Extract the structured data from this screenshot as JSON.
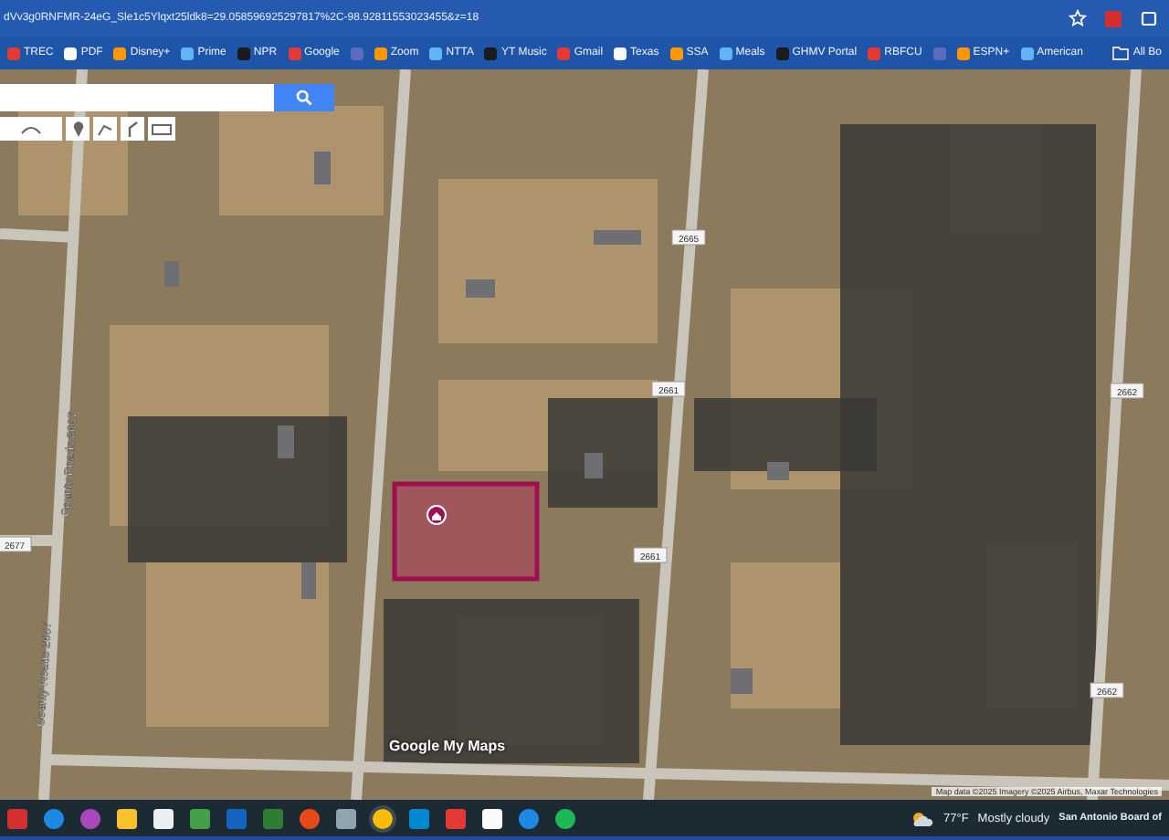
{
  "browser": {
    "url": "dVv3g0RNFMR-24eG_Sle1c5Ylqxt25ldk8=29.058596925297817%2C-98.92811553023455&z=18",
    "bookmarks": [
      {
        "kind": "link",
        "label": "TREC"
      },
      {
        "kind": "link",
        "label": "PDF"
      },
      {
        "kind": "link",
        "label": "Disney+"
      },
      {
        "kind": "link",
        "label": "Prime"
      },
      {
        "kind": "link",
        "label": "NPR"
      },
      {
        "kind": "link",
        "label": "Google"
      },
      {
        "kind": "icon"
      },
      {
        "kind": "link",
        "label": "Zoom"
      },
      {
        "kind": "link",
        "label": "NTTA"
      },
      {
        "kind": "link",
        "label": "YT Music"
      },
      {
        "kind": "link",
        "label": "Gmail"
      },
      {
        "kind": "link",
        "label": "Texas"
      },
      {
        "kind": "link",
        "label": "SSA"
      },
      {
        "kind": "link",
        "label": "Meals"
      },
      {
        "kind": "link",
        "label": "GHMV Portal"
      },
      {
        "kind": "link",
        "label": "RBFCU"
      },
      {
        "kind": "icon"
      },
      {
        "kind": "link",
        "label": "ESPN+"
      },
      {
        "kind": "link",
        "label": "American"
      }
    ],
    "all_bookmarks": "All Bo"
  },
  "map": {
    "road_labels": [
      {
        "text": "County Roads 2667",
        "kind": "vertical"
      },
      {
        "text": "County Roads 2667",
        "kind": "vertical"
      },
      {
        "text": "2665",
        "kind": "shield"
      },
      {
        "text": "2661",
        "kind": "shield"
      },
      {
        "text": "2661",
        "kind": "shield"
      },
      {
        "text": "2662",
        "kind": "shield"
      },
      {
        "text": "2662",
        "kind": "shield"
      },
      {
        "text": "2677",
        "kind": "shield"
      }
    ],
    "logo": "Google My Maps",
    "attribution": "Map data ©2025 Imagery ©2025 Airbus, Maxar Technologies"
  },
  "taskbar": {
    "weather": "77°F",
    "forecast": "Mostly cloudy",
    "notification": "San Antonio Board of"
  }
}
